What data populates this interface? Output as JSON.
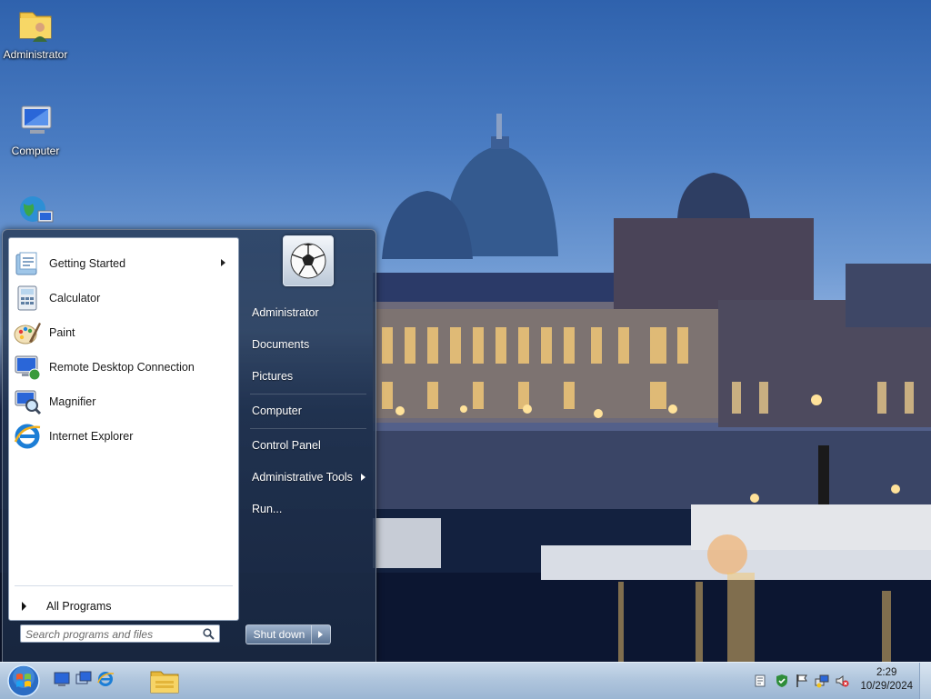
{
  "desktop": {
    "icons": [
      {
        "label": "Administrator",
        "icon": "user-folder-icon"
      },
      {
        "label": "Computer",
        "icon": "computer-icon"
      },
      {
        "label": "",
        "icon": "network-icon"
      }
    ]
  },
  "start_menu": {
    "programs": [
      {
        "label": "Getting Started",
        "icon": "getting-started-icon",
        "has_submenu": true
      },
      {
        "label": "Calculator",
        "icon": "calculator-icon"
      },
      {
        "label": "Paint",
        "icon": "paint-icon"
      },
      {
        "label": "Remote Desktop Connection",
        "icon": "remote-desktop-icon"
      },
      {
        "label": "Magnifier",
        "icon": "magnifier-icon"
      },
      {
        "label": "Internet Explorer",
        "icon": "internet-explorer-icon"
      }
    ],
    "all_programs": "All Programs",
    "search_placeholder": "Search programs and files",
    "user_picture": "soccer-ball-icon",
    "links": [
      {
        "label": "Administrator"
      },
      {
        "label": "Documents"
      },
      {
        "label": "Pictures"
      },
      {
        "label": "Computer"
      },
      {
        "label": "Control Panel"
      },
      {
        "label": "Administrative Tools",
        "has_submenu": true
      },
      {
        "label": "Run..."
      }
    ],
    "shutdown_label": "Shut down"
  },
  "taskbar": {
    "start_icon": "windows-orb-icon",
    "quicklaunch": [
      "show-desktop-icon",
      "switch-windows-icon",
      "internet-explorer-icon"
    ],
    "pinned": [
      "windows-explorer-icon"
    ],
    "tray_icons": [
      "notes-icon",
      "security-shield-icon",
      "action-center-flag-icon",
      "network-icon",
      "volume-muted-icon"
    ],
    "clock": {
      "time": "2:29",
      "date": "10/29/2024"
    }
  },
  "colors": {
    "accent": "#2f62ad",
    "taskbar": "#aec4dc"
  }
}
